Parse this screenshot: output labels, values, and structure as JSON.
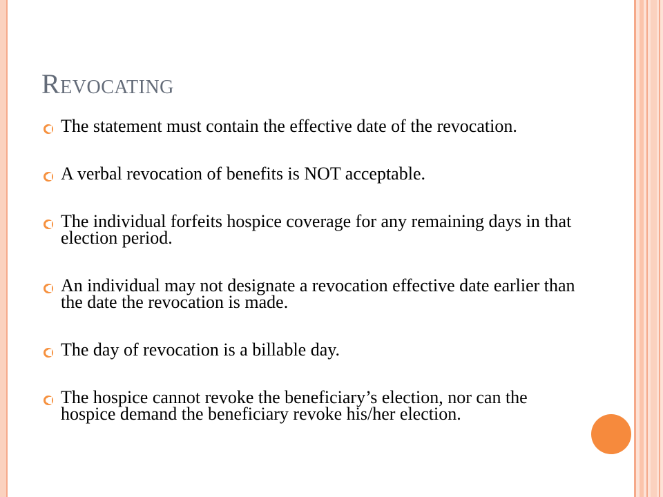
{
  "slide": {
    "title": "Revocating",
    "bullets": [
      "The statement must contain the effective date of the revocation.",
      "A verbal revocation of benefits is NOT acceptable.",
      "The individual forfeits hospice coverage for any remaining days in that election period.",
      "An individual may not designate a revocation effective date earlier than the date the revocation is made.",
      "The day of revocation is a billable day.",
      "The hospice cannot revoke the beneficiary’s election, nor can the hospice demand the beneficiary revoke his/her election."
    ]
  },
  "colors": {
    "accent": "#f68a3d",
    "title": "#636b78",
    "stripe_light": "#fde2d6",
    "stripe_medium": "#fbd2bf",
    "stripe_dark": "#f5a98a"
  },
  "icons": {
    "bullet": "open-circle-bullet-icon",
    "decoration": "orange-circle"
  }
}
